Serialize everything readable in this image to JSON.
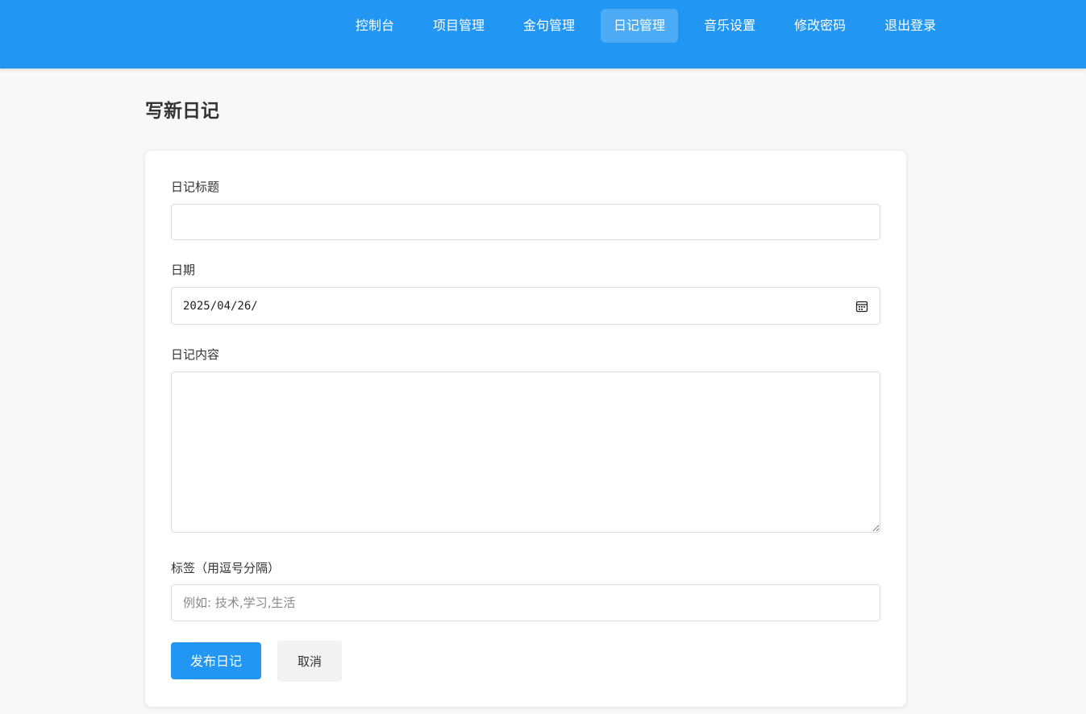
{
  "nav": {
    "items": [
      {
        "label": "控制台",
        "active": false
      },
      {
        "label": "项目管理",
        "active": false
      },
      {
        "label": "金句管理",
        "active": false
      },
      {
        "label": "日记管理",
        "active": true
      },
      {
        "label": "音乐设置",
        "active": false
      },
      {
        "label": "修改密码",
        "active": false
      },
      {
        "label": "退出登录",
        "active": false
      }
    ]
  },
  "page": {
    "title": "写新日记"
  },
  "form": {
    "title_label": "日记标题",
    "title_value": "",
    "date_label": "日期",
    "date_value": "2025/04/26/",
    "content_label": "日记内容",
    "content_value": "",
    "tags_label": "标签（用逗号分隔）",
    "tags_value": "",
    "tags_placeholder": "例如: 技术,学习,生活",
    "submit_label": "发布日记",
    "cancel_label": "取消"
  },
  "colors": {
    "primary": "#2196f3",
    "background": "#f8f8f8",
    "card": "#ffffff",
    "cancel_bg": "#f2f2f2"
  },
  "icons": {
    "date_picker": "calendar-icon"
  }
}
